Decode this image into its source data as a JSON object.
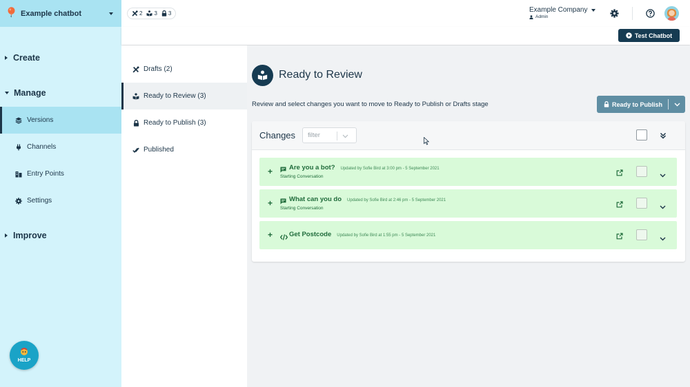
{
  "sidebar": {
    "bot_name": "Example chatbot",
    "sections": {
      "create": "Create",
      "manage": "Manage",
      "improve": "Improve"
    },
    "items": [
      {
        "label": "Versions",
        "icon": "layers-icon",
        "active": true
      },
      {
        "label": "Channels",
        "icon": "plug-icon",
        "active": false
      },
      {
        "label": "Entry Points",
        "icon": "entry-icon",
        "active": false
      },
      {
        "label": "Settings",
        "icon": "gear-icon",
        "active": false
      }
    ],
    "help_label": "HELP"
  },
  "topbar": {
    "counts": [
      {
        "icon": "tools-icon",
        "value": "2"
      },
      {
        "icon": "review-icon",
        "value": "3"
      },
      {
        "icon": "lock-icon",
        "value": "3"
      }
    ],
    "company": "Example Company",
    "role": "Admin"
  },
  "test_button": "Test Chatbot",
  "stages": [
    {
      "label": "Drafts (2)",
      "icon": "tools-icon",
      "active": false
    },
    {
      "label": "Ready to Review (3)",
      "icon": "review-icon",
      "active": true
    },
    {
      "label": "Ready to Publish (3)",
      "icon": "lock-icon",
      "active": false
    },
    {
      "label": "Published",
      "icon": "double-check-icon",
      "active": false
    }
  ],
  "main": {
    "title": "Ready to Review",
    "description": "Review and select changes you want to move to Ready to Publish or Drafts stage",
    "action_button": "Ready to Publish",
    "changes_title": "Changes",
    "filter_placeholder": "filter",
    "rows": [
      {
        "name": "Are you a bot?",
        "icon": "message-icon",
        "updated": "Updated by Sofie Bird at 3:00 pm - 5 September 2021",
        "subtitle": "Starting Conversation"
      },
      {
        "name": "What can you do",
        "icon": "message-icon",
        "updated": "Updated by Sofie Bird at 2:46 pm - 5 September 2021",
        "subtitle": "Starting Conversation"
      },
      {
        "name": "Get Postcode",
        "icon": "code-icon",
        "updated": "Updated by Sofie Bird at 1:55 pm - 5 September 2021",
        "subtitle": ""
      }
    ]
  },
  "colors": {
    "navy": "#163b52",
    "sidebar_bg": "#d3f3fb",
    "sidebar_active": "#a9e3f2",
    "row_green": "#d9fad9",
    "text_green": "#1f6b3a",
    "publish_button": "#5f8ea3"
  }
}
